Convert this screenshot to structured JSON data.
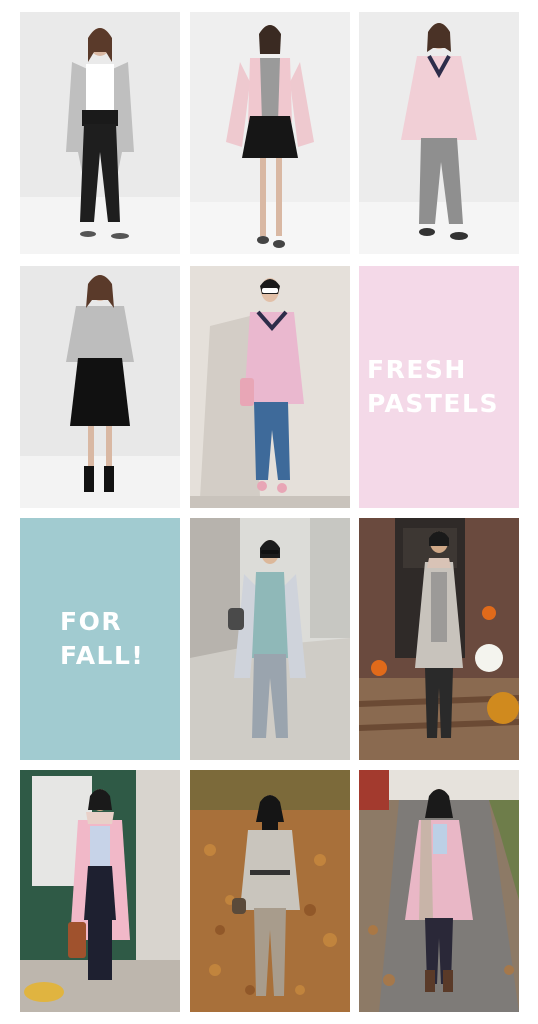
{
  "collage": {
    "tile_fresh": {
      "lines": [
        "FRESH",
        "PASTELS"
      ],
      "background": "#f4d9e8"
    },
    "tile_fall": {
      "lines": [
        "FOR",
        "FALL!"
      ],
      "background": "#a1cbd0"
    },
    "photos": [
      {
        "subject": "model in grey cardigan and black trousers"
      },
      {
        "subject": "model in pink cardigan and black pleated skirt"
      },
      {
        "subject": "model in pink sweater and grey trousers"
      },
      {
        "subject": "model in grey sweater and black skirt"
      },
      {
        "subject": "woman in pink sweater and jeans by wall"
      },
      {
        "subject": "woman in grey cardigan on sidewalk"
      },
      {
        "subject": "woman in grey coat with pumpkins"
      },
      {
        "subject": "woman in pink cardigan by door"
      },
      {
        "subject": "woman in grey sweater in autumn leaves"
      },
      {
        "subject": "woman in pink coat on path"
      }
    ]
  }
}
